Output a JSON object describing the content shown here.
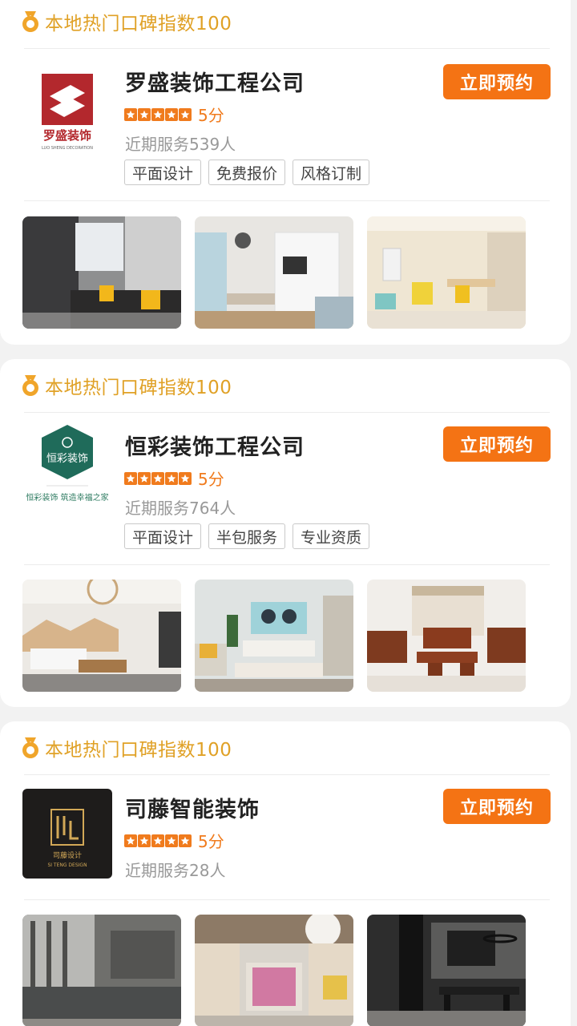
{
  "colors": {
    "accent": "#f47314",
    "badge_text": "#e0a126",
    "star": "#f07b1d",
    "muted": "#999999"
  },
  "cards": [
    {
      "banner_icon": "medal-icon",
      "banner_text": "本地热门口碑指数100",
      "name": "罗盛装饰工程公司",
      "rating": 5,
      "score_label": "5分",
      "served": "近期服务539人",
      "tags": [
        "平面设计",
        "免费报价",
        "风格订制"
      ],
      "book_label": "立即预约",
      "logo_text": "罗盛装饰",
      "logo_sub": "LUO SHENG DECORATION"
    },
    {
      "banner_icon": "medal-icon",
      "banner_text": "本地热门口碑指数100",
      "name": "恒彩装饰工程公司",
      "rating": 5,
      "score_label": "5分",
      "served": "近期服务764人",
      "tags": [
        "平面设计",
        "半包服务",
        "专业资质"
      ],
      "book_label": "立即预约",
      "logo_text": "恒彩装饰",
      "logo_sub": "恒彩装饰 筑造幸福之家"
    },
    {
      "banner_icon": "medal-icon",
      "banner_text": "本地热门口碑指数100",
      "name": "司藤智能装饰",
      "rating": 5,
      "score_label": "5分",
      "served": "近期服务28人",
      "tags": [],
      "book_label": "立即预约",
      "logo_text": "司藤设计",
      "logo_sub": "SI TENG DESIGN"
    }
  ]
}
